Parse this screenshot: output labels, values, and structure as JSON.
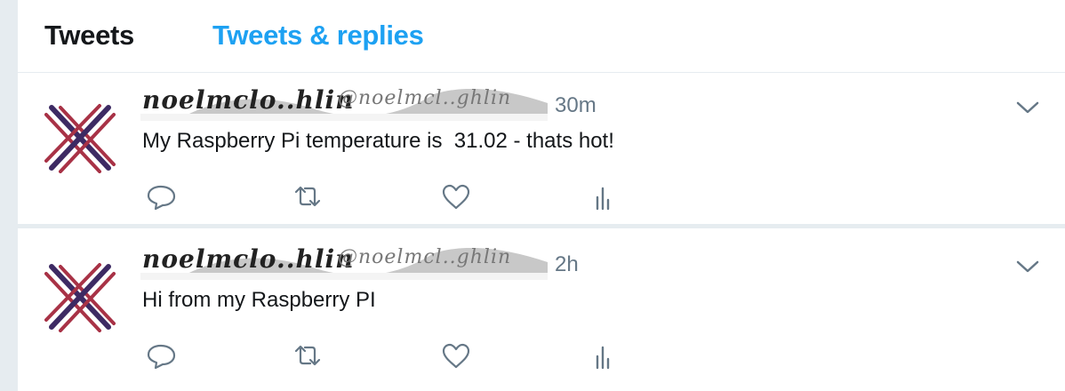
{
  "tabs": [
    {
      "label": "Tweets",
      "active": true
    },
    {
      "label": "Tweets & replies",
      "active": false
    }
  ],
  "colors": {
    "accent": "#1da1f2",
    "text": "#14171a",
    "muted": "#657786",
    "divider": "#e6ecf0",
    "avatar_dark": "#3d2a63",
    "avatar_red": "#a83246"
  },
  "tweets": [
    {
      "author_name": "noelmclo..hlin",
      "author_handle": "@noelmcl..ghlin",
      "time": "30m",
      "text": "My Raspberry Pi temperature is  31.02 - thats hot!",
      "actions": [
        "reply-icon",
        "retweet-icon",
        "like-icon",
        "analytics-icon"
      ]
    },
    {
      "author_name": "noelmclo..hlin",
      "author_handle": "@noelmcl..ghlin",
      "time": "2h",
      "text": "Hi from my Raspberry PI",
      "actions": [
        "reply-icon",
        "retweet-icon",
        "like-icon",
        "analytics-icon"
      ]
    }
  ]
}
